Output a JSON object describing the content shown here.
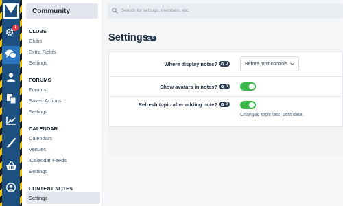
{
  "rail": {
    "items": [
      {
        "icon": "gears-icon",
        "badge": "1"
      },
      {
        "icon": "comments-icon"
      },
      {
        "icon": "user-icon"
      },
      {
        "icon": "copy-icon"
      },
      {
        "icon": "chart-line-icon"
      },
      {
        "icon": "brush-icon"
      },
      {
        "icon": "basket-icon"
      },
      {
        "icon": "user-circle-icon"
      }
    ],
    "active_index": 1
  },
  "sidebar": {
    "title": "Community",
    "sections": [
      {
        "title": "CLUBS",
        "items": [
          "Clubs",
          "Extra Fields",
          "Settings"
        ]
      },
      {
        "title": "FORUMS",
        "items": [
          "Forums",
          "Saved Actions",
          "Settings"
        ]
      },
      {
        "title": "CALENDAR",
        "items": [
          "Calendars",
          "Venues",
          "iCalendar Feeds",
          "Settings"
        ]
      },
      {
        "title": "CONTENT NOTES",
        "items": [
          "Settings"
        ]
      }
    ]
  },
  "search": {
    "placeholder": "Search for settings, members, etc."
  },
  "page": {
    "title": "Settings",
    "tag": "0"
  },
  "settings": {
    "display_notes": {
      "label": "Where display notes?",
      "tag": "0",
      "value": "Before post controls"
    },
    "show_avatars": {
      "label": "Show avatars in notes?",
      "tag": "0",
      "enabled": true
    },
    "refresh_topic": {
      "label": "Refresh topic after adding note?",
      "tag": "0",
      "enabled": true,
      "hint": "Changed topic last_post date."
    }
  },
  "colors": {
    "accent": "#2a73bd",
    "toggle_on": "#3cb54a",
    "rail": "#1d4f80",
    "badge": "#e0393e"
  }
}
